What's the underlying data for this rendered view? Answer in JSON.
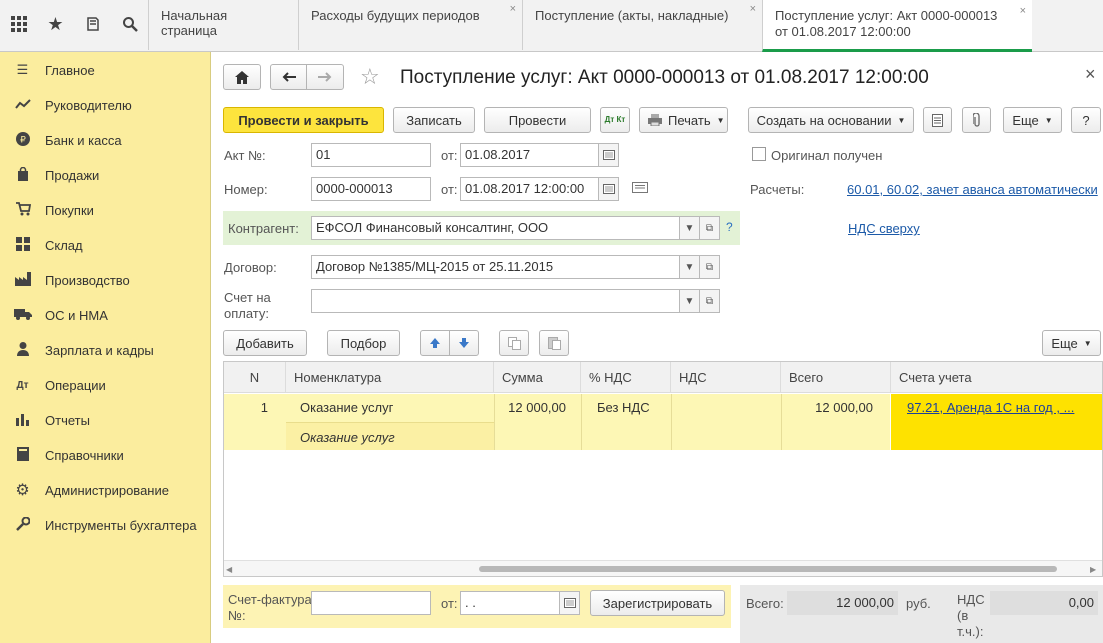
{
  "toolbar_top": {
    "tabs": [
      {
        "label": "Начальная страница"
      },
      {
        "label": "Расходы будущих периодов"
      },
      {
        "label": "Поступление (акты, накладные)"
      },
      {
        "label_line1": "Поступление услуг: Акт 0000-000013",
        "label_line2": "от 01.08.2017 12:00:00"
      }
    ],
    "close_glyph": "×"
  },
  "sidebar": {
    "items": [
      {
        "label": "Главное"
      },
      {
        "label": "Руководителю"
      },
      {
        "label": "Банк и касса"
      },
      {
        "label": "Продажи"
      },
      {
        "label": "Покупки"
      },
      {
        "label": "Склад"
      },
      {
        "label": "Производство"
      },
      {
        "label": "ОС и НМА"
      },
      {
        "label": "Зарплата и кадры"
      },
      {
        "label": "Операции"
      },
      {
        "label": "Отчеты"
      },
      {
        "label": "Справочники"
      },
      {
        "label": "Администрирование"
      },
      {
        "label": "Инструменты бухгалтера"
      }
    ]
  },
  "form": {
    "title": "Поступление услуг: Акт 0000-000013 от 01.08.2017 12:00:00",
    "buttons": {
      "post_close": "Провести и закрыть",
      "save": "Записать",
      "post": "Провести",
      "dtkt": "Дт Кт",
      "print": "Печать",
      "create_based": "Создать на основании",
      "more": "Еще",
      "help": "?"
    },
    "act_no_label": "Акт №:",
    "act_no_value": "01",
    "from_label": "от:",
    "act_date": "01.08.2017",
    "number_label": "Номер:",
    "number_value": "0000-000013",
    "number_date": "01.08.2017 12:00:00",
    "original_label": "Оригинал получен",
    "settlements_label": "Расчеты:",
    "settlements_link": "60.01, 60.02, зачет аванса автоматически",
    "vat_link": "НДС сверху",
    "counterparty_label": "Контрагент:",
    "counterparty_value": "ЕФСОЛ Финансовый консалтинг, ООО",
    "question": "?",
    "contract_label": "Договор:",
    "contract_value": "Договор №1385/МЦ-2015 от 25.11.2015",
    "invoice_label_1": "Счет на",
    "invoice_label_2": "оплату:",
    "invoice_value": ""
  },
  "table_toolbar": {
    "add": "Добавить",
    "select": "Подбор",
    "more": "Еще"
  },
  "table": {
    "headers": [
      "N",
      "Номенклатура",
      "Сумма",
      "% НДС",
      "НДС",
      "Всего",
      "Счета учета"
    ],
    "rows": [
      {
        "n": "1",
        "item": "Оказание услуг",
        "item_content": "Оказание услуг",
        "sum": "12 000,00",
        "vat_rate": "Без НДС",
        "vat": "",
        "total": "12 000,00",
        "accounts": "97.21, Аренда 1С на год , ..."
      }
    ]
  },
  "footer": {
    "invoice_label_1": "Счет-фактура",
    "invoice_label_2": "№:",
    "invoice_no": "",
    "from_label": "от:",
    "invoice_date": " .  .",
    "register_button": "Зарегистрировать",
    "total_label": "Всего:",
    "total_value": "12 000,00",
    "currency": "руб.",
    "vat_label_1": "НДС",
    "vat_label_2": "(в",
    "vat_label_3": "т.ч.):",
    "vat_value": "0,00"
  }
}
